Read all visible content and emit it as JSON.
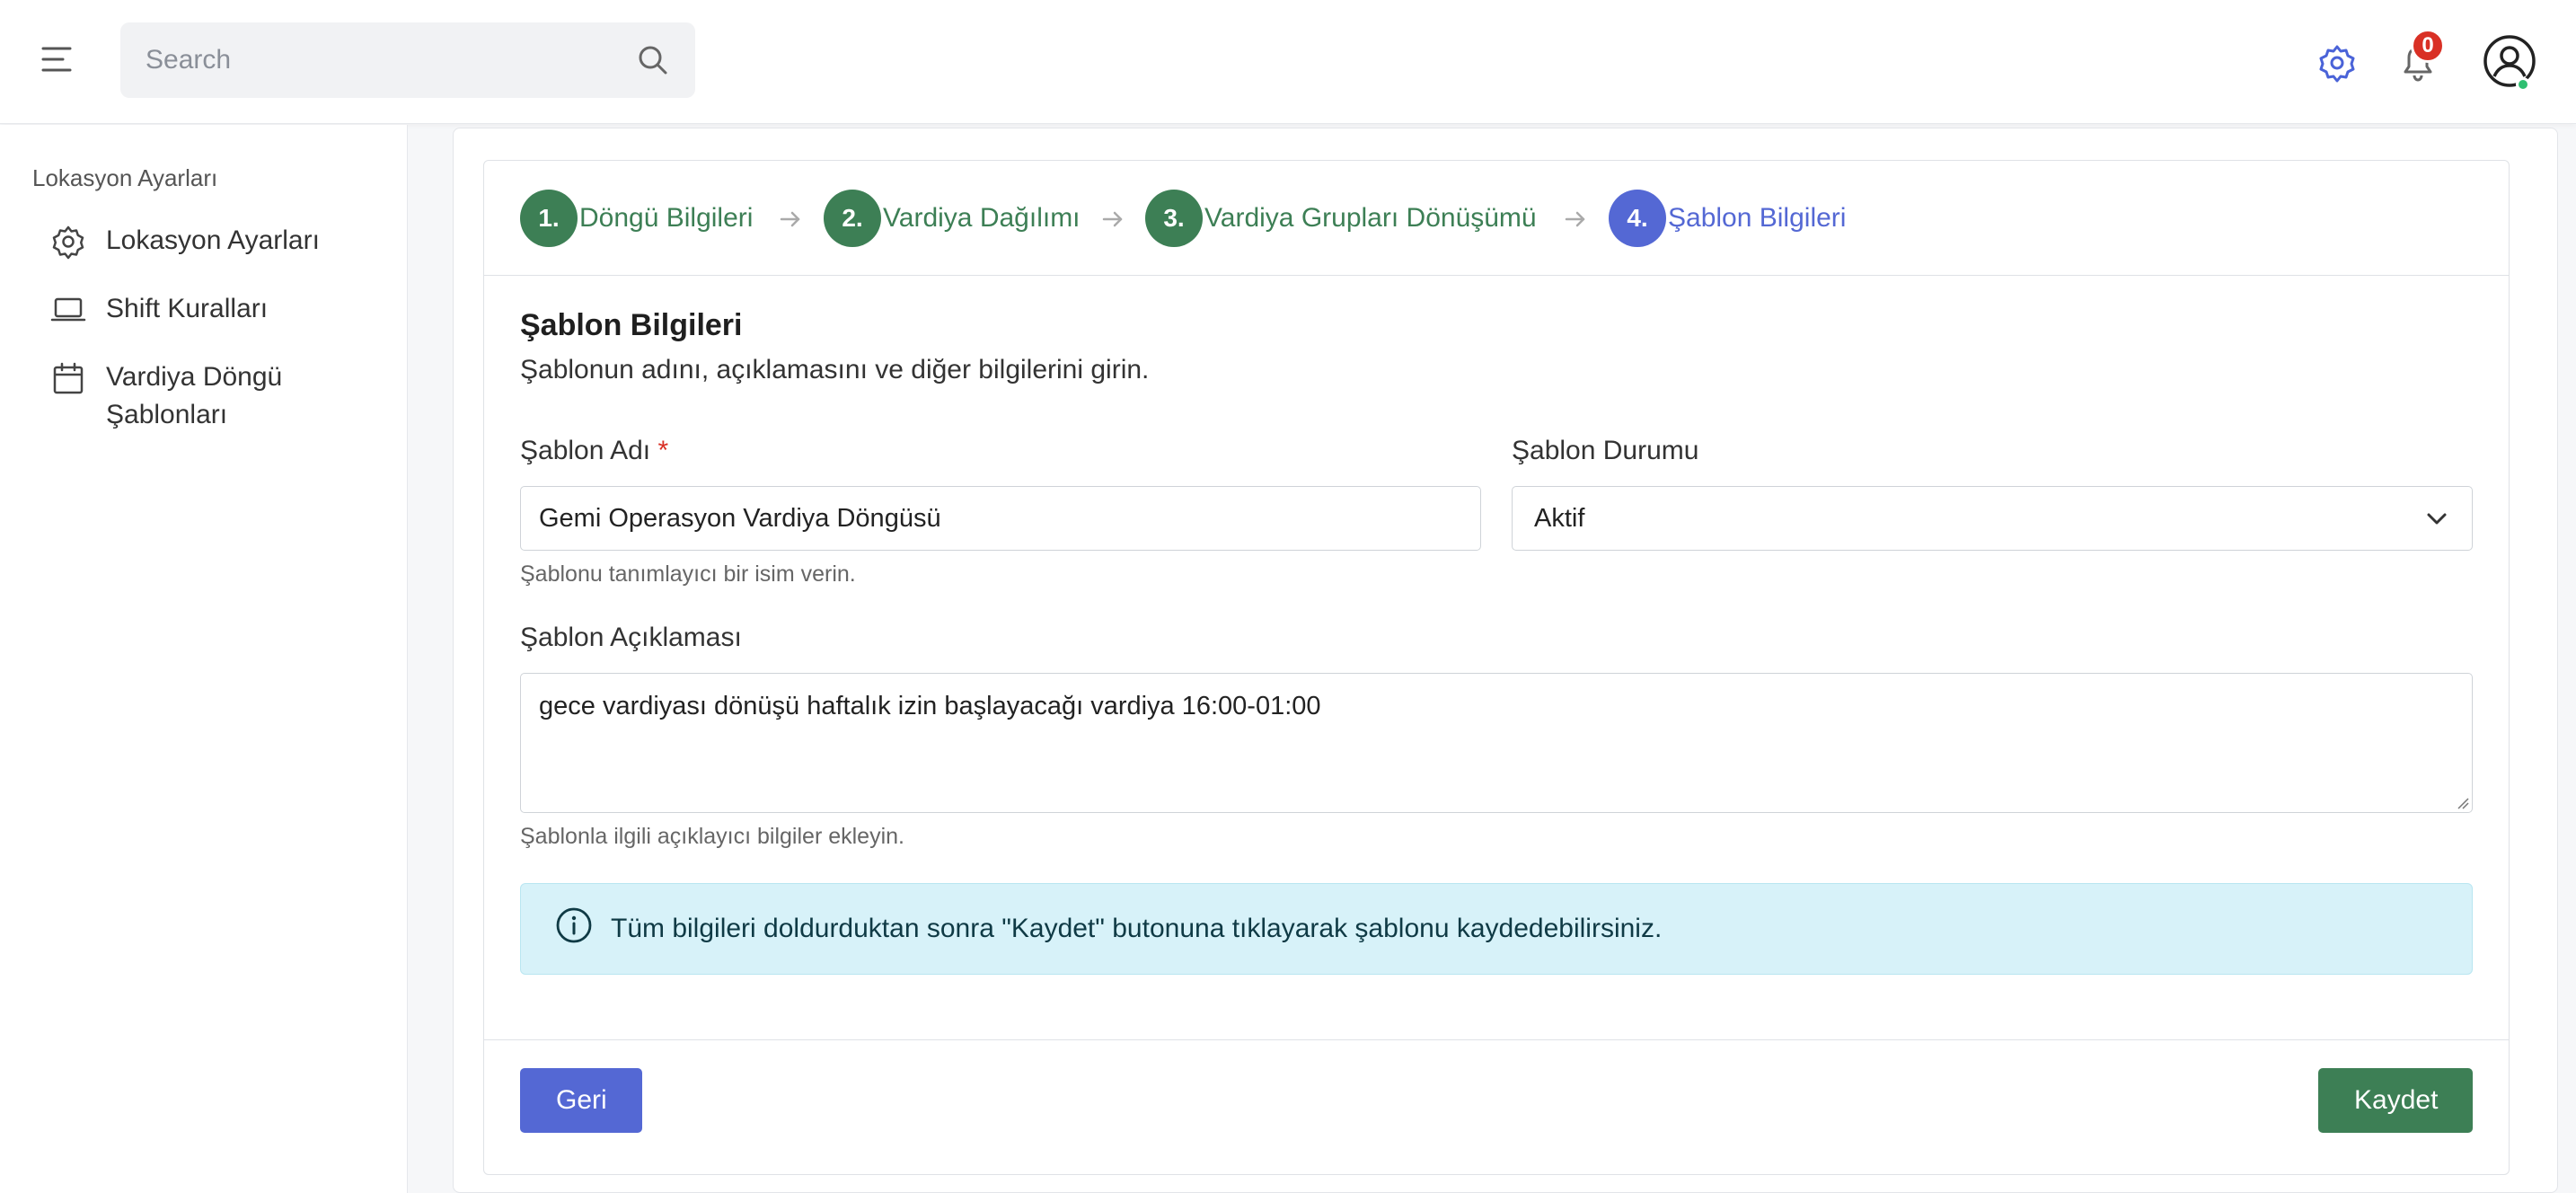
{
  "header": {
    "search_placeholder": "Search",
    "notification_count": "0"
  },
  "sidebar": {
    "section_title": "Lokasyon Ayarları",
    "items": [
      {
        "label": "Lokasyon Ayarları",
        "icon": "gear-icon"
      },
      {
        "label": "Shift Kuralları",
        "icon": "laptop-icon"
      },
      {
        "label": "Vardiya Döngü Şablonları",
        "icon": "calendar-icon"
      }
    ]
  },
  "steps": [
    {
      "number": "1.",
      "label": "Döngü Bilgileri",
      "state": "completed"
    },
    {
      "number": "2.",
      "label": "Vardiya Dağılımı",
      "state": "completed"
    },
    {
      "number": "3.",
      "label": "Vardiya Grupları Dönüşümü",
      "state": "completed"
    },
    {
      "number": "4.",
      "label": "Şablon Bilgileri",
      "state": "active"
    }
  ],
  "form": {
    "title": "Şablon Bilgileri",
    "description": "Şablonun adını, açıklamasını ve diğer bilgilerini girin.",
    "name_label": "Şablon Adı",
    "name_required": "*",
    "name_value": "Gemi Operasyon Vardiya Döngüsü",
    "name_help": "Şablonu tanımlayıcı bir isim verin.",
    "status_label": "Şablon Durumu",
    "status_value": "Aktif",
    "desc_label": "Şablon Açıklaması",
    "desc_value": "gece vardiyası dönüşü haftalık izin başlayacağı vardiya 16:00-01:00",
    "desc_help": "Şablonla ilgili açıklayıcı bilgiler ekleyin.",
    "info_message": "Tüm bilgileri doldurduktan sonra \"Kaydet\" butonuna tıklayarak şablonu kaydedebilirsiniz."
  },
  "footer": {
    "back_label": "Geri",
    "save_label": "Kaydet"
  },
  "colors": {
    "step_completed": "#3d7f55",
    "step_active": "#5468d4",
    "info_bg": "#d7f2f9",
    "badge": "#d93025"
  }
}
